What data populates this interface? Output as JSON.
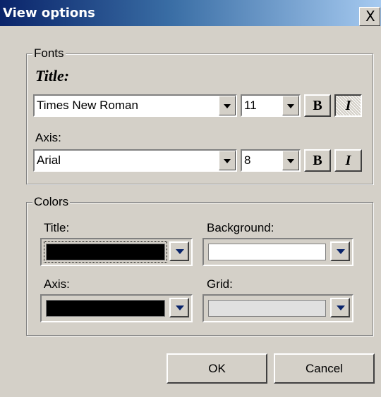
{
  "window": {
    "title": "View options",
    "close_label": "X"
  },
  "fonts_group": {
    "legend": "Fonts",
    "title_label": "Title:",
    "title_font": "Times New Roman",
    "title_size": "11",
    "title_bold": "B",
    "title_italic": "I",
    "axis_label": "Axis:",
    "axis_font": "Arial",
    "axis_size": "8",
    "axis_bold": "B",
    "axis_italic": "I"
  },
  "colors_group": {
    "legend": "Colors",
    "title_label": "Title:",
    "title_color": "#000000",
    "background_label": "Background:",
    "background_color": "#ffffff",
    "axis_label": "Axis:",
    "axis_color": "#000000",
    "grid_label": "Grid:",
    "grid_color": "#e0e0e0"
  },
  "buttons": {
    "ok": "OK",
    "cancel": "Cancel"
  }
}
